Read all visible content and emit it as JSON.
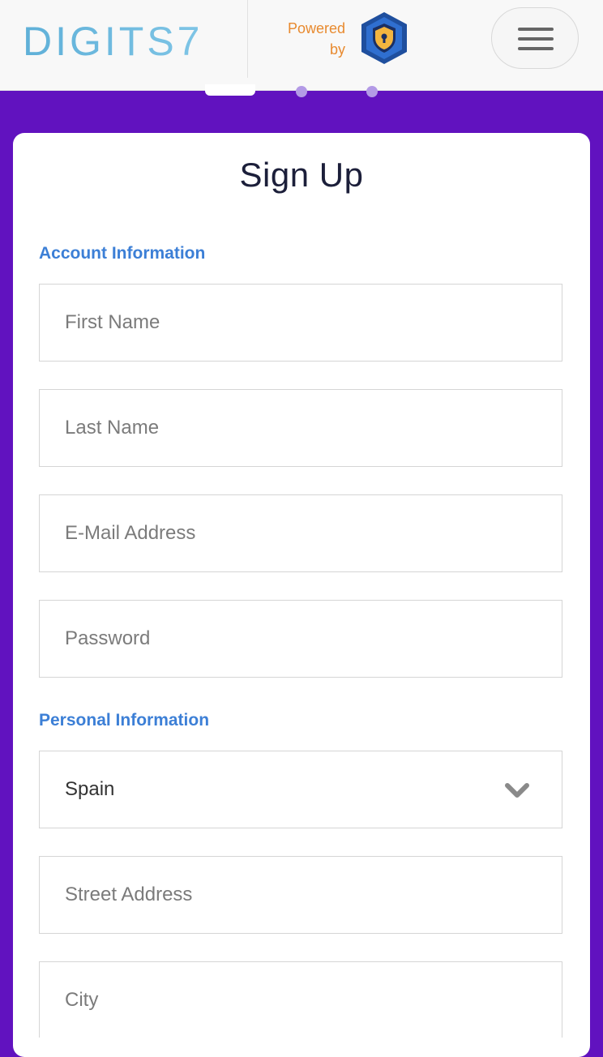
{
  "header": {
    "brand": "DIGITS7",
    "powered_line1": "Powered",
    "powered_line2": "by",
    "shield_icon": "shield-lock-icon",
    "menu_icon": "hamburger-icon"
  },
  "carousel": {
    "active_index": 0,
    "count": 3
  },
  "form": {
    "title": "Sign Up",
    "account_section": "Account Information",
    "personal_section": "Personal Information",
    "first_name_placeholder": "First Name",
    "last_name_placeholder": "Last Name",
    "email_placeholder": "E-Mail Address",
    "password_placeholder": "Password",
    "country_value": "Spain",
    "street_placeholder": "Street Address",
    "city_placeholder": "City"
  },
  "colors": {
    "background": "#6112bf",
    "accent_blue": "#3c7fd6",
    "powered_orange": "#e88a2f"
  }
}
